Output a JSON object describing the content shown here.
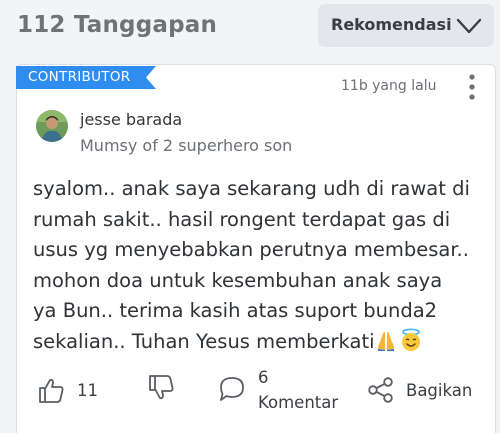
{
  "header": {
    "count_label": "112 Tanggapan",
    "sort_label": "Rekomendasi",
    "sort_icon": "chevron-down-icon"
  },
  "comment": {
    "badge": "CONTRIBUTOR",
    "badge_color": "#2f8df0",
    "time_ago": "11b yang lalu",
    "author": {
      "name": "jesse barada",
      "description": "Mumsy of 2 superhero son"
    },
    "body_lines": [
      "syalom.. anak saya sekarang udh di rawat di",
      "rumah sakit.. hasil rongent terdapat gas di",
      "usus yg menyebabkan perutnya membesar..",
      "mohon doa untuk kesembuhan anak saya",
      "ya Bun.. terima kasih atas suport bunda2",
      "sekalian.. Tuhan Yesus memberkati"
    ],
    "trailing_emojis": [
      "praying-hands-emoji",
      "smiling-face-with-halo-emoji"
    ]
  },
  "actions": {
    "like_count": "11",
    "comment_count": "6",
    "comment_label": "Komentar",
    "share_label": "Bagikan",
    "icons": [
      "thumbs-up-icon",
      "thumbs-down-icon",
      "comment-bubble-icon",
      "share-icon"
    ]
  }
}
